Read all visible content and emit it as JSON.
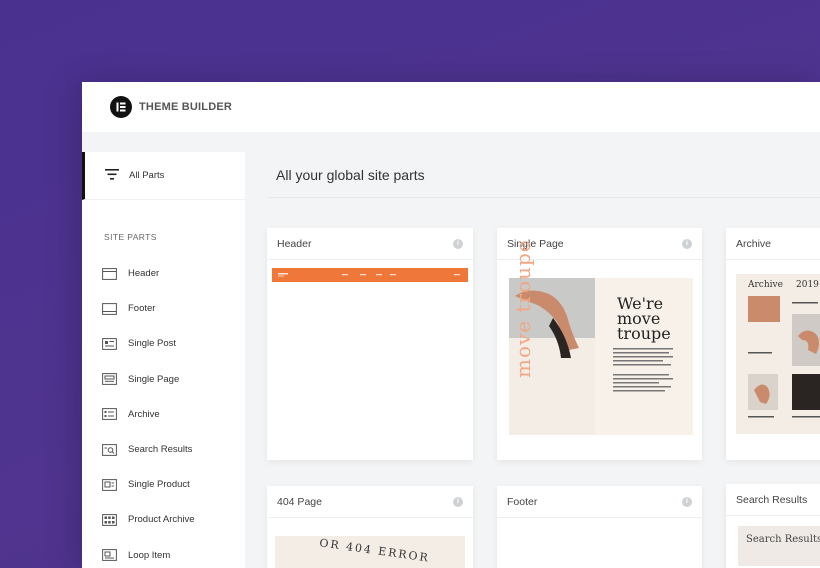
{
  "app": {
    "brand": "THEME BUILDER",
    "logo_icon": "elementor-logo-icon"
  },
  "sidebar": {
    "all_parts": "All Parts",
    "section_title": "SITE PARTS",
    "items": [
      {
        "label": "Header",
        "icon": "header-icon"
      },
      {
        "label": "Footer",
        "icon": "footer-icon"
      },
      {
        "label": "Single Post",
        "icon": "single-post-icon"
      },
      {
        "label": "Single Page",
        "icon": "single-page-icon"
      },
      {
        "label": "Archive",
        "icon": "archive-icon"
      },
      {
        "label": "Search Results",
        "icon": "search-results-icon"
      },
      {
        "label": "Single Product",
        "icon": "single-product-icon"
      },
      {
        "label": "Product Archive",
        "icon": "product-archive-icon"
      },
      {
        "label": "Loop Item",
        "icon": "loop-item-icon"
      }
    ]
  },
  "main": {
    "title": "All your global site parts",
    "cards": [
      {
        "title": "Header"
      },
      {
        "title": "Single Page"
      },
      {
        "title": "Archive"
      },
      {
        "title": "404 Page"
      },
      {
        "title": "Footer"
      },
      {
        "title": "Search Results"
      }
    ],
    "previews": {
      "single_page_heading": "We're move troupe",
      "single_page_side": "move troupe",
      "archive_heading": "Archive",
      "archive_year": "2019",
      "page404_text": "OR 404 ERROR",
      "search_text": "Search Results"
    }
  },
  "colors": {
    "background": "#4a3190",
    "accent_orange": "#f0773a",
    "peach": "#f2a784"
  }
}
